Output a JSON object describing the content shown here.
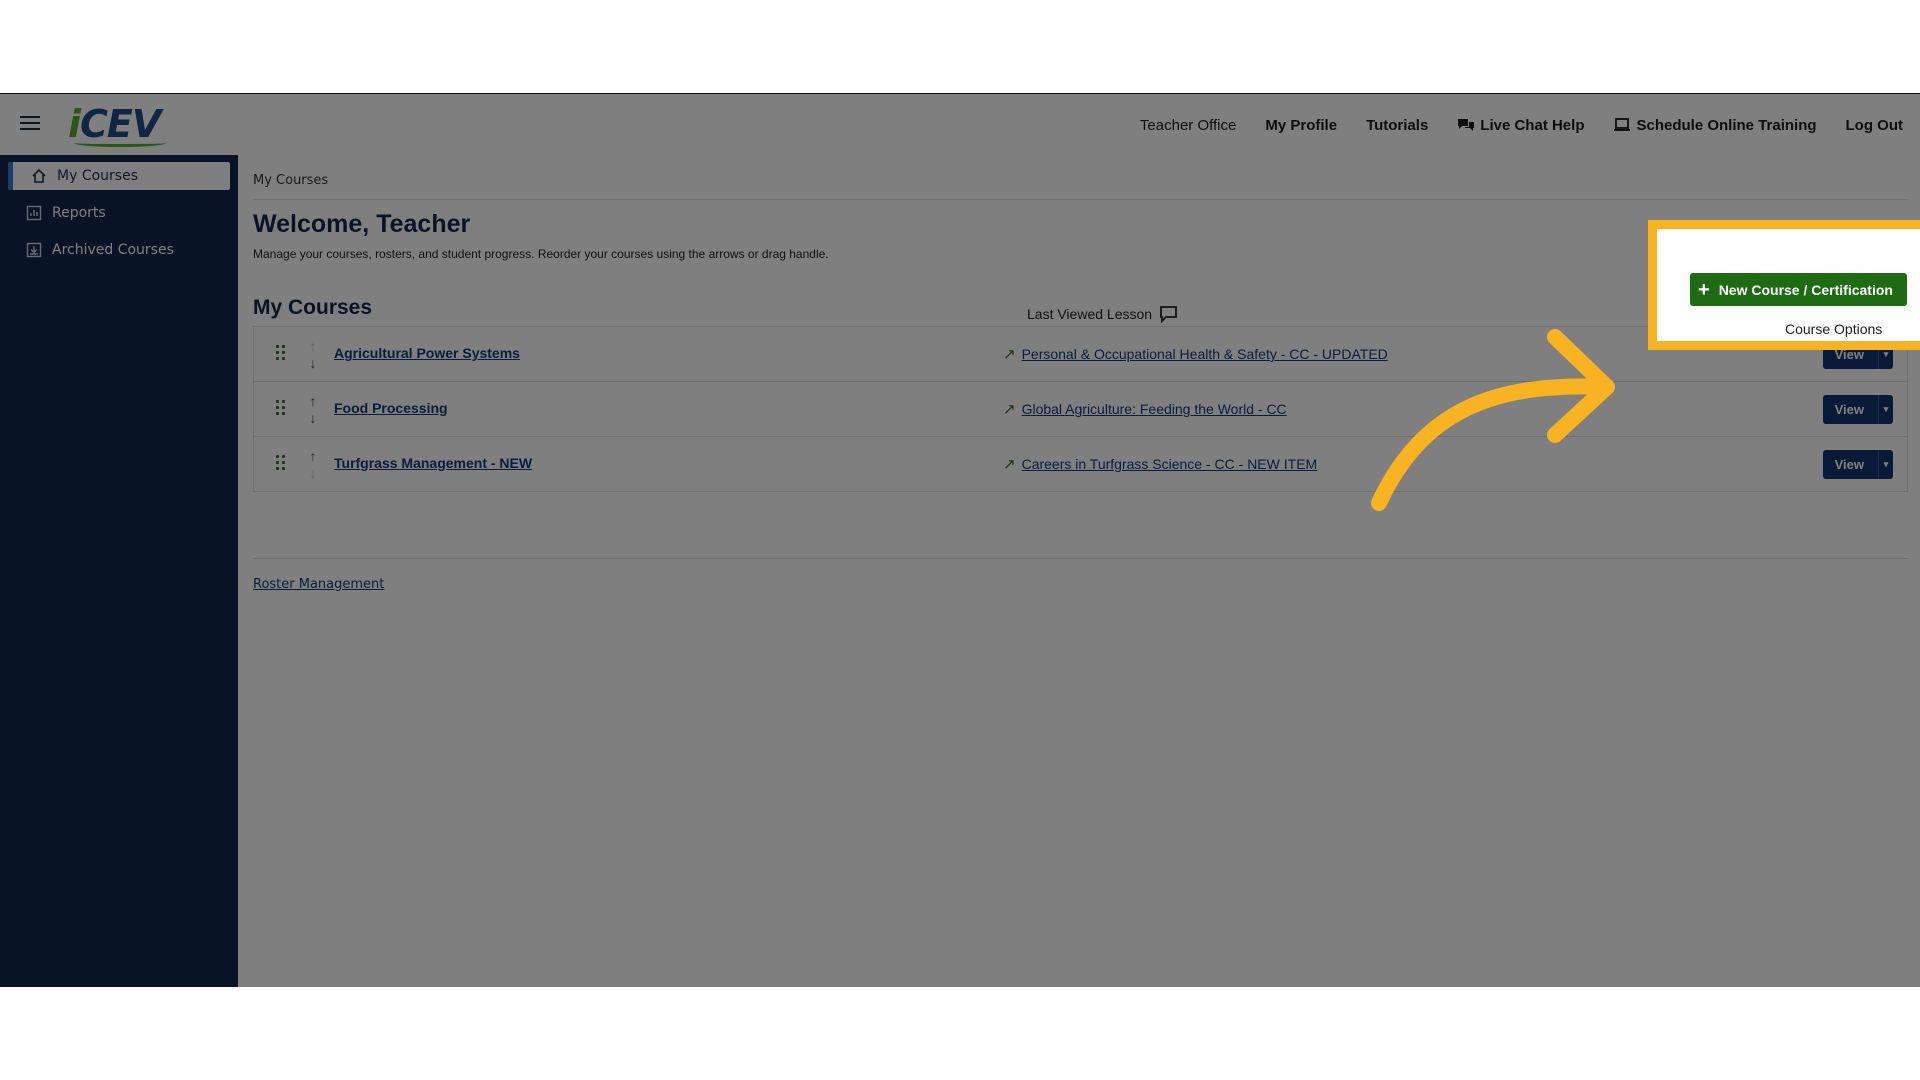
{
  "header": {
    "logo_text": "iCEV",
    "nav": [
      {
        "label": "Teacher Office",
        "bold": false
      },
      {
        "label": "My Profile",
        "bold": true
      },
      {
        "label": "Tutorials",
        "bold": true
      },
      {
        "label": "Live Chat Help",
        "bold": true,
        "icon": "chat-bubbles-icon"
      },
      {
        "label": "Schedule Online Training",
        "bold": true,
        "icon": "laptop-icon"
      },
      {
        "label": "Log Out",
        "bold": true
      }
    ]
  },
  "sidebar": {
    "items": [
      {
        "label": "My Courses",
        "icon": "home-icon",
        "active": true
      },
      {
        "label": "Reports",
        "icon": "chart-icon",
        "active": false
      },
      {
        "label": "Archived Courses",
        "icon": "archive-icon",
        "active": false
      }
    ]
  },
  "main": {
    "breadcrumb": "My Courses",
    "welcome": "Welcome, Teacher",
    "subtitle": "Manage your courses, rosters, and student progress. Reorder your courses using the arrows or drag handle.",
    "section_title": "My Courses",
    "last_viewed_header": "Last Viewed Lesson",
    "new_course_button": "New Course / Certification",
    "course_options": "Course Options",
    "courses": [
      {
        "name": "Agricultural Power Systems",
        "last_lesson": "Personal & Occupational Health & Safety - CC - UPDATED",
        "view": "View",
        "up_enabled": false,
        "down_enabled": true
      },
      {
        "name": "Food Processing",
        "last_lesson": "Global Agriculture: Feeding the World - CC",
        "view": "View",
        "up_enabled": true,
        "down_enabled": true
      },
      {
        "name": "Turfgrass Management - NEW",
        "last_lesson": "Careers in Turfgrass Science - CC - NEW ITEM",
        "view": "View",
        "up_enabled": true,
        "down_enabled": false
      }
    ],
    "roster_link": "Roster Management"
  },
  "colors": {
    "sidebar_bg": "#11274a",
    "primary_green": "#1f6b13",
    "view_button": "#11356e",
    "highlight": "#f7b322"
  }
}
